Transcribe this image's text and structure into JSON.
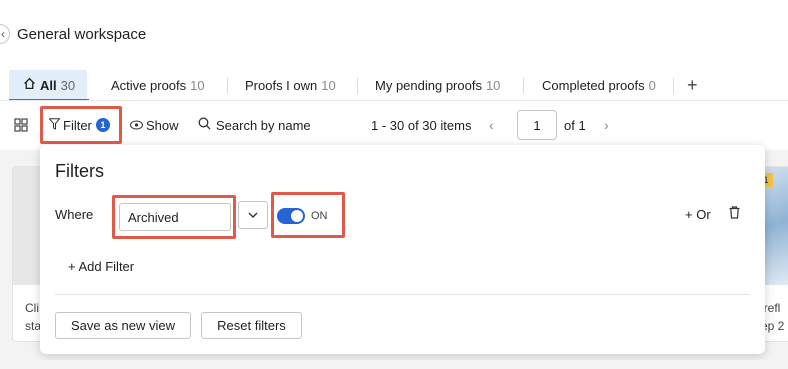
{
  "header": {
    "title": "General workspace"
  },
  "tabs": [
    {
      "label": "All",
      "count": "30",
      "active": true
    },
    {
      "label": "Active proofs",
      "count": "10"
    },
    {
      "label": "Proofs I own",
      "count": "10"
    },
    {
      "label": "My pending proofs",
      "count": "10"
    },
    {
      "label": "Completed proofs",
      "count": "0"
    }
  ],
  "tabs_add": "+",
  "toolbar": {
    "filter_label": "Filter",
    "filter_count": "1",
    "show_label": "Show",
    "search_label": "Search by name",
    "items_label": "1 - 30 of 30 items",
    "page_value": "1",
    "page_of": "of 1"
  },
  "cards": {
    "left_text": "Cli\nsta",
    "right_text": "irefl\nep 2",
    "right_tag": "1"
  },
  "filters_panel": {
    "title": "Filters",
    "where_label": "Where",
    "field_value": "Archived",
    "toggle_label": "ON",
    "toggle_on": true,
    "or_label": "+ Or",
    "add_filter_label": "+ Add Filter",
    "save_view_label": "Save as new view",
    "reset_label": "Reset filters"
  },
  "colors": {
    "accent": "#2563d6",
    "highlight_border": "#e05a4a",
    "active_tab_bg": "#e3eefb"
  }
}
